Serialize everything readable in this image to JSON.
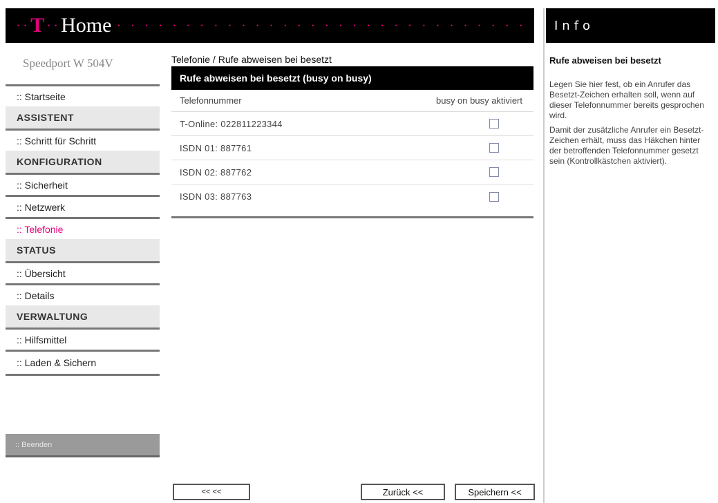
{
  "header": {
    "dots_left": "··",
    "logo": "T",
    "title": "Home",
    "dots_right": "· · · · · · · · · · · · · · · · · · · · · · · · · · · · · · · · · · · · · · · · · · · · · · · · · · · · · · · · · · · · · · · · · · · · · · · · · ·"
  },
  "info_header": "Info",
  "sidebar": {
    "brand": "Speedport W 504V",
    "items": [
      {
        "type": "link",
        "label": ":: Startseite"
      },
      {
        "type": "head",
        "label": "ASSISTENT"
      },
      {
        "type": "link",
        "label": ":: Schritt für Schritt"
      },
      {
        "type": "head",
        "label": "KONFIGURATION"
      },
      {
        "type": "link",
        "label": ":: Sicherheit"
      },
      {
        "type": "link",
        "label": ":: Netzwerk"
      },
      {
        "type": "link",
        "label": ":: Telefonie"
      },
      {
        "type": "head",
        "label": "STATUS"
      },
      {
        "type": "link",
        "label": ":: Übersicht"
      },
      {
        "type": "link",
        "label": ":: Details"
      },
      {
        "type": "head",
        "label": "VERWALTUNG"
      },
      {
        "type": "link",
        "label": ":: Hilfsmittel"
      },
      {
        "type": "link",
        "label": ":: Laden & Sichern"
      }
    ],
    "logout": ":: Beenden"
  },
  "main": {
    "breadcrumb": "Telefonie / Rufe abweisen bei besetzt",
    "section_title": "Rufe abweisen bei besetzt (busy on busy)",
    "col_number": "Telefonnummer",
    "col_active": "busy on busy aktiviert",
    "rows": [
      {
        "number": "T-Online: 022811223344",
        "checked": false
      },
      {
        "number": "ISDN 01: 887761",
        "checked": false
      },
      {
        "number": "ISDN 02: 887762",
        "checked": false
      },
      {
        "number": "ISDN 03: 887763",
        "checked": false
      }
    ]
  },
  "buttons": {
    "back": "<< <<",
    "prev": "Zurück <<",
    "save": "Speichern <<"
  },
  "info": {
    "title": "Rufe abweisen bei besetzt",
    "p1": "Legen Sie hier fest, ob ein Anrufer das Besetzt-Zeichen erhalten soll, wenn auf dieser Telefonnummer bereits gesprochen wird.",
    "p2": "Damit der zusätzliche Anrufer ein Besetzt-Zeichen erhält, muss das Häkchen hinter der betroffenden Telefonnummer gesetzt sein (Kontrollkästchen aktiviert)."
  },
  "colors": {
    "accent": "#e2007a",
    "bar": "#000000",
    "section_head_bg": "#e8e8e8"
  }
}
